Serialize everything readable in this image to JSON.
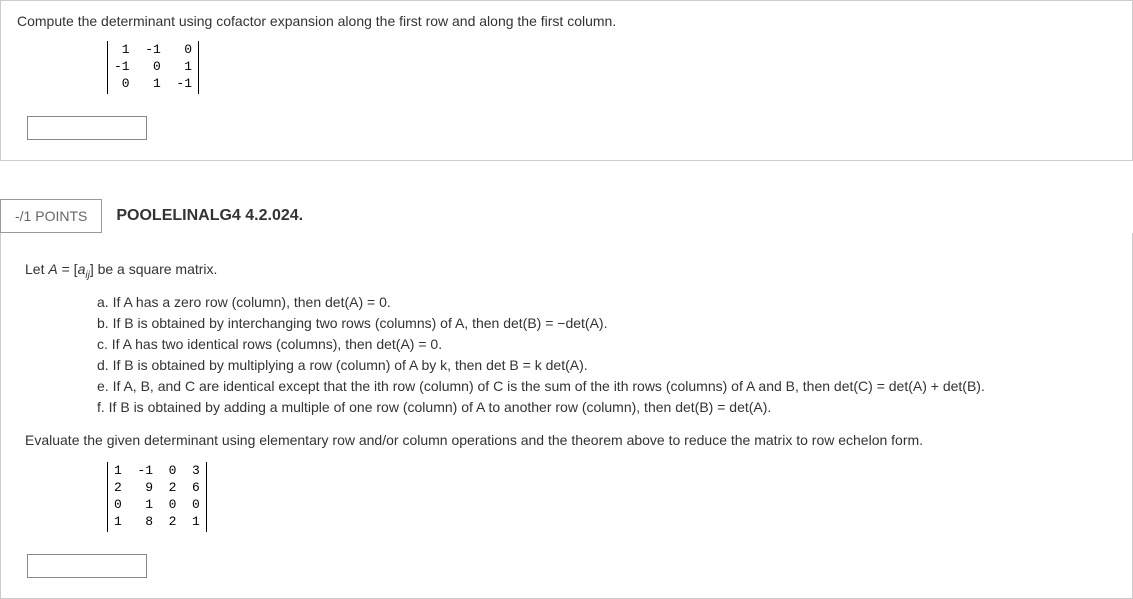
{
  "q1": {
    "prompt": "Compute the determinant using cofactor expansion along the first row and along the first column.",
    "matrix": [
      " 1  -1   0",
      "-1   0   1",
      " 0   1  -1"
    ],
    "answer": ""
  },
  "header": {
    "points": "-/1 POINTS",
    "ref": "POOLELINALG4 4.2.024."
  },
  "q2": {
    "letA_pre": "Let ",
    "letA_A": "A",
    "letA_eq": " = [",
    "letA_a": "a",
    "letA_sub": "ij",
    "letA_post": "] be a square matrix.",
    "theorems": {
      "a": "a. If A has a zero row (column), then det(A) = 0.",
      "b": "b. If B is obtained by interchanging two rows (columns) of A, then det(B) = −det(A).",
      "c": "c. If A has two identical rows (columns), then det(A) = 0.",
      "d": "d. If B is obtained by multiplying a row (column) of A by k, then det B = k det(A).",
      "e": "e. If A, B, and C are identical except that the ith row (column) of C is the sum of the ith rows (columns) of A and B, then det(C) = det(A) + det(B).",
      "f": "f. If B is obtained by adding a multiple of one row (column) of A to another row (column), then det(B) = det(A)."
    },
    "evaluate": "Evaluate the given determinant using elementary row and/or column operations and the theorem above to reduce the matrix to row echelon form.",
    "matrix": [
      "1  -1  0  3",
      "2   9  2  6",
      "0   1  0  0",
      "1   8  2  1"
    ],
    "answer": ""
  }
}
